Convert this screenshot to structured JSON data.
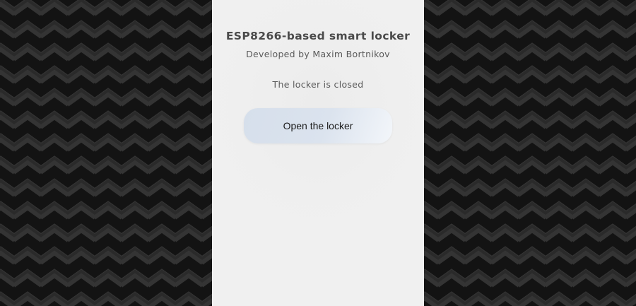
{
  "page": {
    "title": "ESP8266-based smart locker",
    "author": "Developed by Maxim Bortnikov",
    "status": "The locker is closed"
  },
  "controls": {
    "open_label": "Open the locker"
  },
  "colors": {
    "pattern_dark": "#131313",
    "pattern_light": "#333333",
    "panel_background": "#efefef",
    "button_gradient_start": "#d6dfeb",
    "button_gradient_end": "#f3f6fa"
  }
}
